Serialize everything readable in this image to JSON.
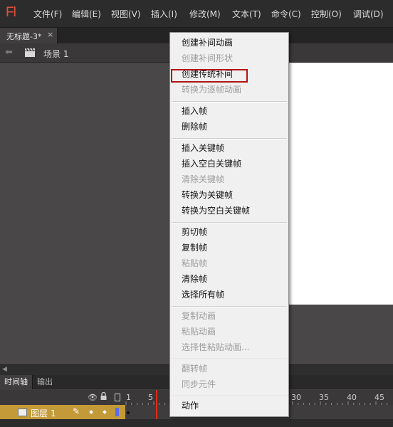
{
  "app": {
    "logo": "Fl"
  },
  "menubar": {
    "items": [
      "文件(F)",
      "编辑(E)",
      "视图(V)",
      "插入(I)",
      "修改(M)",
      "文本(T)",
      "命令(C)",
      "控制(O)",
      "调试(D)"
    ]
  },
  "document": {
    "tab_title": "无标题-3*",
    "close_glyph": "×"
  },
  "editbar": {
    "scene_label": "场景 1"
  },
  "timeline": {
    "tabs": [
      "时间轴",
      "输出"
    ],
    "frame_numbers": [
      "1",
      "5",
      "30",
      "35",
      "40",
      "45"
    ],
    "layer_name": "图层 1"
  },
  "context_menu": {
    "groups": [
      [
        {
          "label": "创建补间动画",
          "enabled": true
        },
        {
          "label": "创建补间形状",
          "enabled": false
        },
        {
          "label": "创建传统补间",
          "enabled": true,
          "highlighted": true
        },
        {
          "label": "转换为逐帧动画",
          "enabled": false
        }
      ],
      [
        {
          "label": "插入帧",
          "enabled": true
        },
        {
          "label": "删除帧",
          "enabled": true
        }
      ],
      [
        {
          "label": "插入关键帧",
          "enabled": true
        },
        {
          "label": "插入空白关键帧",
          "enabled": true
        },
        {
          "label": "清除关键帧",
          "enabled": false
        },
        {
          "label": "转换为关键帧",
          "enabled": true
        },
        {
          "label": "转换为空白关键帧",
          "enabled": true
        }
      ],
      [
        {
          "label": "剪切帧",
          "enabled": true
        },
        {
          "label": "复制帧",
          "enabled": true
        },
        {
          "label": "粘贴帧",
          "enabled": false
        },
        {
          "label": "清除帧",
          "enabled": true
        },
        {
          "label": "选择所有帧",
          "enabled": true
        }
      ],
      [
        {
          "label": "复制动画",
          "enabled": false
        },
        {
          "label": "粘贴动画",
          "enabled": false
        },
        {
          "label": "选择性粘贴动画...",
          "enabled": false
        }
      ],
      [
        {
          "label": "翻转帧",
          "enabled": false
        },
        {
          "label": "同步元件",
          "enabled": false
        }
      ],
      [
        {
          "label": "动作",
          "enabled": true
        }
      ]
    ]
  },
  "colors": {
    "menu_highlight_box": "#b31313",
    "layer_row": "#c49a38",
    "playhead": "#e02a1a",
    "logo": "#e2513c"
  }
}
